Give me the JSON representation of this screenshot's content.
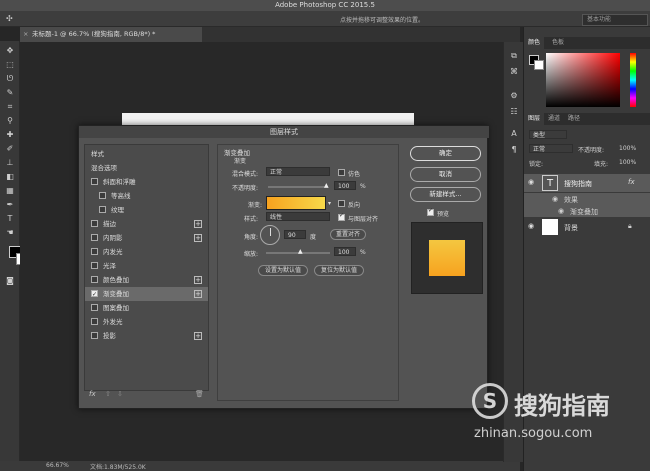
{
  "app": {
    "title": "Adobe Photoshop CC 2015.5"
  },
  "options_bar": {
    "hint": "点按并拖移可调整效果的位置。",
    "workspace": "基本功能"
  },
  "doc_tab": {
    "label": "未标题-1 @ 66.7% (搜狗指南, RGB/8*) *"
  },
  "status": {
    "zoom": "66.67%",
    "doc_info": "文档:1.83M/525.0K"
  },
  "color_panel": {
    "tabs": [
      "颜色",
      "色板"
    ]
  },
  "layers_panel": {
    "tabs": [
      "图层",
      "通道",
      "路径"
    ],
    "filter_label": "类型",
    "blend_mode": "正常",
    "opacity_label": "不透明度:",
    "opacity_value": "100%",
    "lock_label": "锁定:",
    "fill_label": "填充:",
    "fill_value": "100%",
    "layers": [
      {
        "name": "搜狗指南",
        "thumb": "T",
        "fx": "fx"
      },
      {
        "name": "效果"
      },
      {
        "name": "渐变叠加"
      },
      {
        "name": "背景"
      }
    ]
  },
  "dialog": {
    "title": "图层样式",
    "styles": [
      {
        "label": "样式",
        "checkbox": false,
        "plus": false,
        "checked": false
      },
      {
        "label": "混合选项",
        "checkbox": false,
        "plus": false,
        "checked": false
      },
      {
        "label": "斜面和浮雕",
        "checkbox": true,
        "plus": false,
        "checked": false
      },
      {
        "label": "等高线",
        "checkbox": true,
        "plus": false,
        "checked": false
      },
      {
        "label": "纹理",
        "checkbox": true,
        "plus": false,
        "checked": false
      },
      {
        "label": "描边",
        "checkbox": true,
        "plus": true,
        "checked": false
      },
      {
        "label": "内阴影",
        "checkbox": true,
        "plus": true,
        "checked": false
      },
      {
        "label": "内发光",
        "checkbox": true,
        "plus": false,
        "checked": false
      },
      {
        "label": "光泽",
        "checkbox": true,
        "plus": false,
        "checked": false
      },
      {
        "label": "颜色叠加",
        "checkbox": true,
        "plus": true,
        "checked": false
      },
      {
        "label": "渐变叠加",
        "checkbox": true,
        "plus": true,
        "checked": true
      },
      {
        "label": "图案叠加",
        "checkbox": true,
        "plus": false,
        "checked": false
      },
      {
        "label": "外发光",
        "checkbox": true,
        "plus": false,
        "checked": false
      },
      {
        "label": "投影",
        "checkbox": true,
        "plus": true,
        "checked": false
      }
    ],
    "footer_fx": "fx",
    "section_title": "渐变叠加",
    "section_sub": "渐变",
    "blend_label": "混合模式:",
    "blend_value": "正常",
    "dither_label": "仿色",
    "opacity_label": "不透明度:",
    "opacity_value": "100",
    "percent": "%",
    "gradient_label": "渐变:",
    "reverse_label": "反向",
    "style_label": "样式:",
    "style_value": "线性",
    "align_label": "与图层对齐",
    "angle_label": "角度:",
    "angle_value": "90",
    "degree": "度",
    "reset_align": "重置对齐",
    "scale_label": "缩放:",
    "scale_value": "100",
    "set_default": "设置为默认值",
    "reset_default": "复位为默认值",
    "ok": "确定",
    "cancel": "取消",
    "new_style": "新建样式...",
    "preview_label": "预览"
  },
  "watermark": {
    "logo": "S",
    "brand": "搜狗指南",
    "url": "zhinan.sogou.com"
  }
}
